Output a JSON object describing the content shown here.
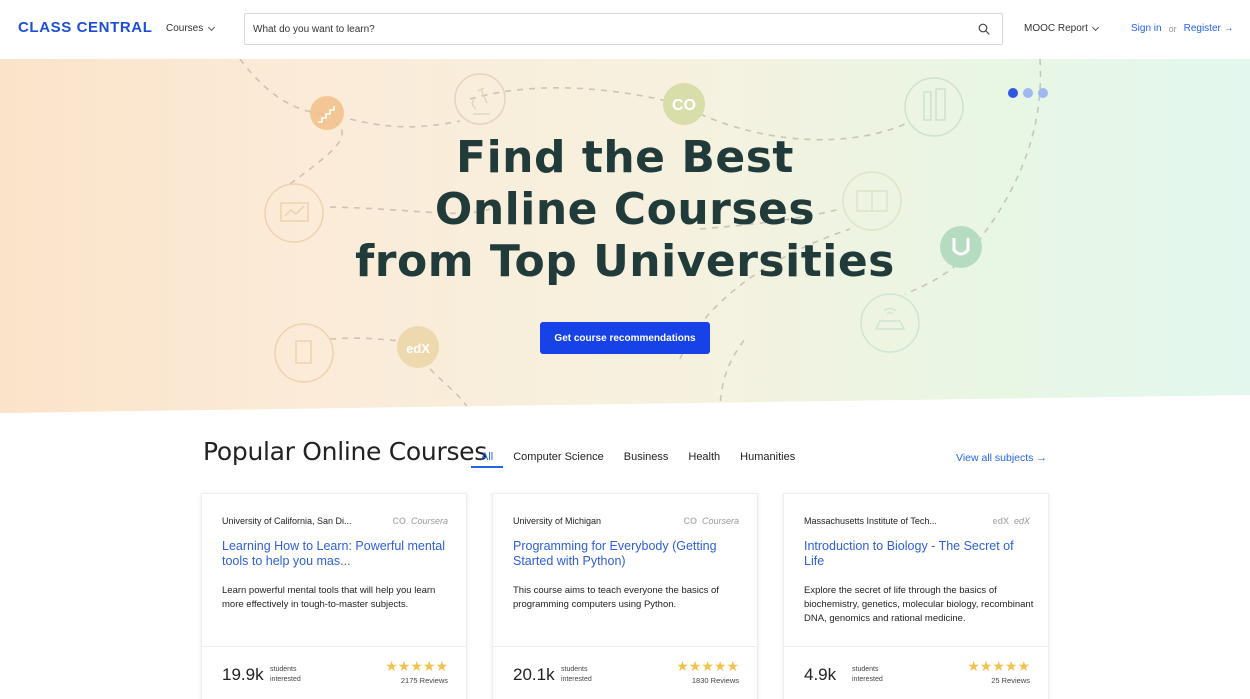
{
  "header": {
    "logo": "CLASS CENTRAL",
    "courses_label": "Courses",
    "search_placeholder": "What do you want to learn?",
    "mooc_report_label": "MOOC Report",
    "sign_in": "Sign in",
    "or": "or",
    "register": "Register →"
  },
  "hero": {
    "title_lines": [
      "Find the Best",
      "Online Courses",
      "from Top Universities"
    ],
    "cta_label": "Get course recommendations",
    "carousel_dots": 3,
    "active_dot": 0,
    "provider_badges": [
      "coursera",
      "edX",
      "udacity"
    ]
  },
  "popular": {
    "title": "Popular Online Courses",
    "tabs": [
      {
        "label": "All",
        "active": true
      },
      {
        "label": "Computer Science",
        "active": false
      },
      {
        "label": "Business",
        "active": false
      },
      {
        "label": "Health",
        "active": false
      },
      {
        "label": "Humanities",
        "active": false
      }
    ],
    "view_all": "View all subjects →",
    "cards": [
      {
        "institution": "University of California, San Di...",
        "provider": "Coursera",
        "provider_logo": "coursera-icon",
        "title": "Learning How to Learn: Powerful mental tools to help you mas...",
        "description": "Learn powerful mental tools that will help you learn more effectively in tough-to-master subjects.",
        "students": "19.9k",
        "students_label_1": "students",
        "students_label_2": "interested",
        "stars": "★★★★★",
        "rating": 5,
        "reviews": "2175 Reviews"
      },
      {
        "institution": "University of Michigan",
        "provider": "Coursera",
        "provider_logo": "coursera-icon",
        "title": "Programming for Everybody (Getting Started with Python)",
        "description": "This course aims to teach everyone the basics of programming computers using Python.",
        "students": "20.1k",
        "students_label_1": "students",
        "students_label_2": "interested",
        "stars": "★★★★★",
        "rating": 5,
        "reviews": "1830 Reviews"
      },
      {
        "institution": "Massachusetts Institute of Tech...",
        "provider": "edX",
        "provider_logo": "edx-icon",
        "title": "Introduction to Biology - The Secret of Life",
        "description": "Explore the secret of life through the basics of biochemistry, genetics, molecular biology, recombinant DNA, genomics and rational medicine.",
        "students": "4.9k",
        "students_label_1": "students",
        "students_label_2": "interested",
        "stars": "★★★★★",
        "rating": 4.5,
        "reviews": "25 Reviews"
      }
    ]
  },
  "colors": {
    "brand_blue": "#1d4ed8",
    "link_blue": "#2563eb",
    "cta_blue": "#1742e8",
    "star_yellow": "#f2c14e",
    "hero_title": "#213a3a"
  }
}
